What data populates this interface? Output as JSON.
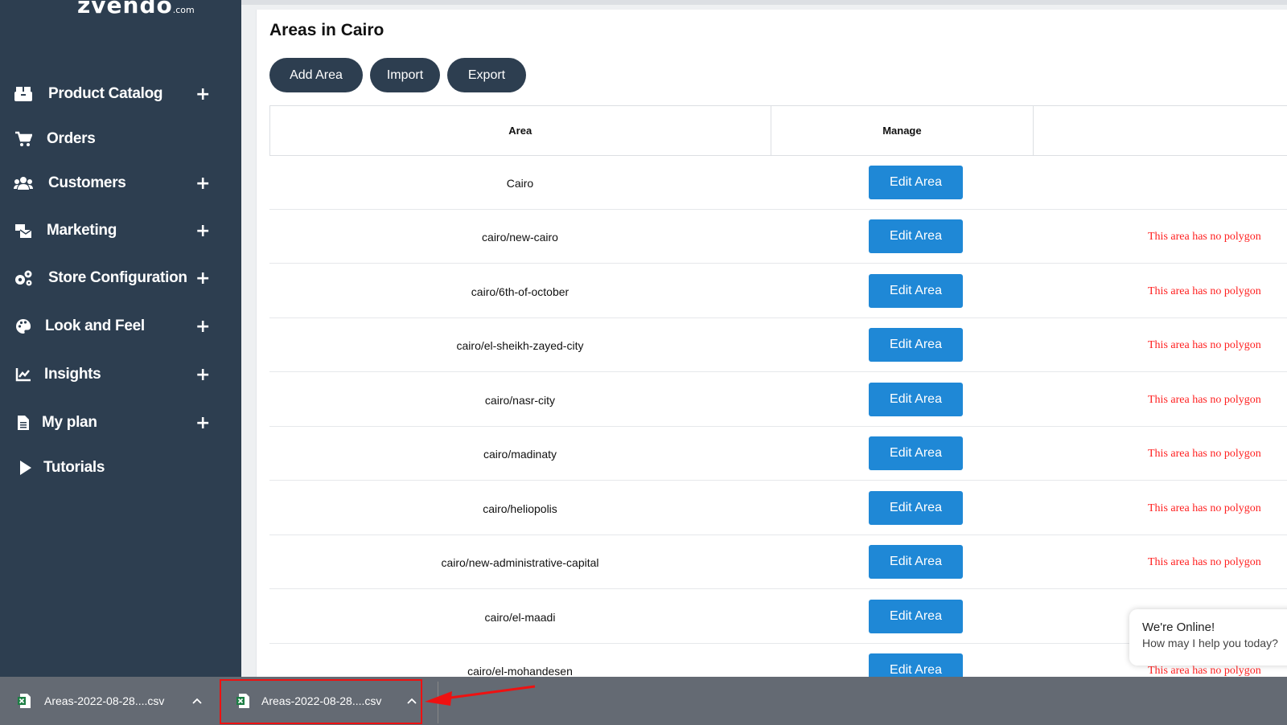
{
  "brand": {
    "logo": "zvendo",
    "logo_suffix": ".com"
  },
  "sidebar": {
    "items": [
      {
        "label": "Product Catalog",
        "icon": "boxes-icon",
        "expandable": true
      },
      {
        "label": "Orders",
        "icon": "cart-icon",
        "expandable": false
      },
      {
        "label": "Customers",
        "icon": "users-icon",
        "expandable": true
      },
      {
        "label": "Marketing",
        "icon": "mail-bulk-icon",
        "expandable": true
      },
      {
        "label": "Store Configuration",
        "icon": "cogs-icon",
        "expandable": true
      },
      {
        "label": "Look and Feel",
        "icon": "palette-icon",
        "expandable": true
      },
      {
        "label": "Insights",
        "icon": "line-chart-icon",
        "expandable": true
      },
      {
        "label": "My plan",
        "icon": "document-icon",
        "expandable": true
      },
      {
        "label": "Tutorials",
        "icon": "play-icon",
        "expandable": false
      }
    ],
    "plus": "+"
  },
  "main": {
    "title": "Areas in Cairo",
    "buttons": {
      "add": "Add Area",
      "import": "Import",
      "export": "Export"
    },
    "table": {
      "headers": [
        "Area",
        "Manage",
        ""
      ],
      "edit_label": "Edit Area",
      "no_polygon": "This area has no polygon",
      "rows": [
        {
          "area": "Cairo",
          "has_polygon": true
        },
        {
          "area": "cairo/new-cairo",
          "has_polygon": false
        },
        {
          "area": "cairo/6th-of-october",
          "has_polygon": false
        },
        {
          "area": "cairo/el-sheikh-zayed-city",
          "has_polygon": false
        },
        {
          "area": "cairo/nasr-city",
          "has_polygon": false
        },
        {
          "area": "cairo/madinaty",
          "has_polygon": false
        },
        {
          "area": "cairo/heliopolis",
          "has_polygon": false
        },
        {
          "area": "cairo/new-administrative-capital",
          "has_polygon": false
        },
        {
          "area": "cairo/el-maadi",
          "has_polygon": true
        },
        {
          "area": "cairo/el-mohandesen",
          "has_polygon": false
        }
      ]
    }
  },
  "chat": {
    "title": "We're Online!",
    "subtitle": "How may I help you today?"
  },
  "downloads": [
    {
      "filename": "Areas-2022-08-28....csv",
      "icon": "excel-file-icon"
    },
    {
      "filename": "Areas-2022-08-28....csv",
      "icon": "excel-file-icon"
    }
  ],
  "colors": {
    "sidebar": "#2d3e50",
    "edit_button": "#1f88d6",
    "no_polygon_text": "#ff2020",
    "highlight": "#e11111"
  }
}
